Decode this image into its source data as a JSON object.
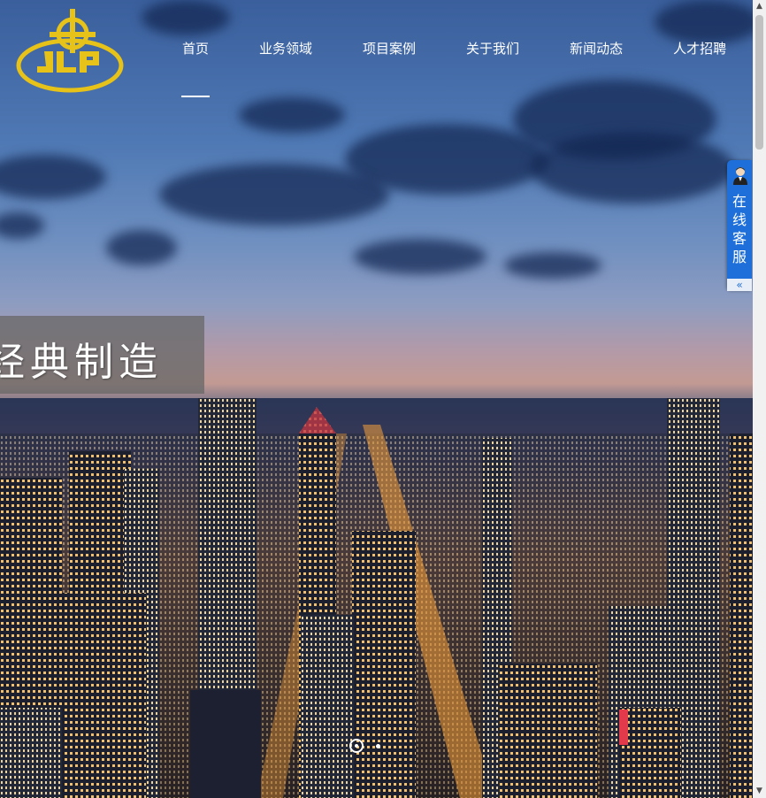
{
  "header": {
    "nav": [
      {
        "label": "首页"
      },
      {
        "label": "业务领域"
      },
      {
        "label": "项目案例"
      },
      {
        "label": "关于我们"
      },
      {
        "label": "新闻动态"
      },
      {
        "label": "人才招聘"
      }
    ],
    "active_index": 0
  },
  "logo": {
    "text": "JLP",
    "color": "#e7c218"
  },
  "banner": {
    "slogan": "经典制造",
    "slide_count": 2,
    "active_slide": 0
  },
  "service": {
    "label": "在线客服",
    "collapse": "«",
    "accent": "#1e6fd9"
  },
  "scrollbar": {
    "up": "▲",
    "down": "▼"
  }
}
